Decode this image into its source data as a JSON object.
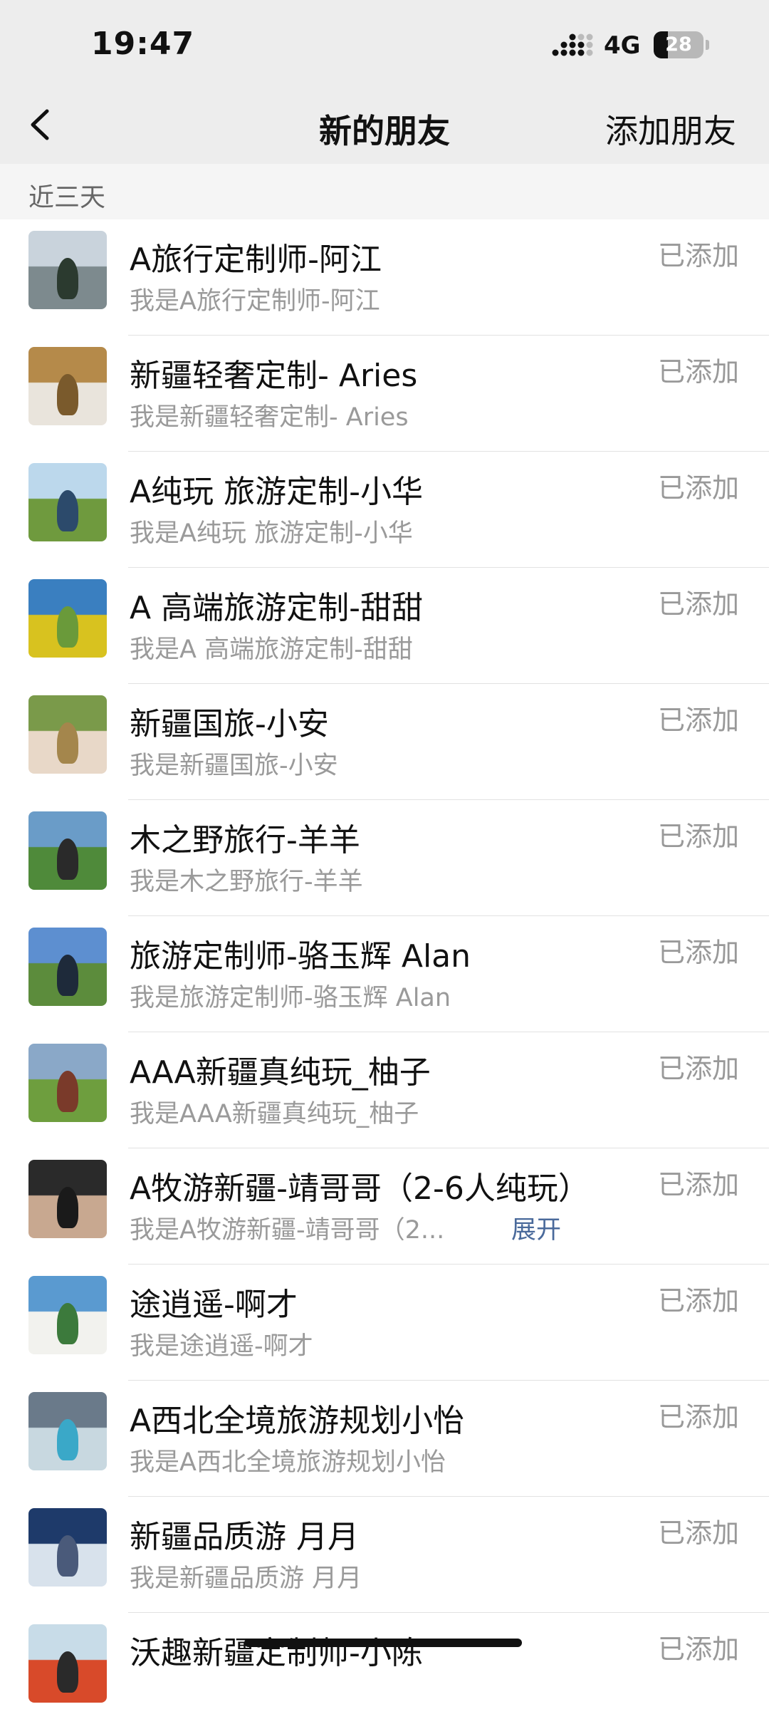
{
  "status_bar": {
    "time": "19:47",
    "network": "4G",
    "battery": "28",
    "battery_level": 0.28
  },
  "nav": {
    "title": "新的朋友",
    "action": "添加朋友",
    "back_icon": "chevron-left-icon"
  },
  "section": {
    "label": "近三天"
  },
  "requests": [
    {
      "name": "A旅行定制师-阿江",
      "message": "我是A旅行定制师-阿江",
      "status": "已添加",
      "avatar": [
        "#c9d3dc",
        "#7d8a8e",
        "#2b3a2f"
      ]
    },
    {
      "name": "新疆轻奢定制- Aries",
      "message": "我是新疆轻奢定制- Aries",
      "status": "已添加",
      "avatar": [
        "#b58a4a",
        "#e9e4dc",
        "#7a5a2c"
      ]
    },
    {
      "name": "A纯玩 旅游定制-小华",
      "message": "我是A纯玩 旅游定制-小华",
      "status": "已添加",
      "avatar": [
        "#bcd8ec",
        "#6f9a3e",
        "#2c4a6b"
      ]
    },
    {
      "name": "A 高端旅游定制-甜甜",
      "message": "我是A 高端旅游定制-甜甜",
      "status": "已添加",
      "avatar": [
        "#3a7fc0",
        "#d8c21f",
        "#6a9a3a"
      ]
    },
    {
      "name": "新疆国旅-小安",
      "message": "我是新疆国旅-小安",
      "status": "已添加",
      "avatar": [
        "#7a9a4a",
        "#e8d8c8",
        "#a4864c"
      ]
    },
    {
      "name": "木之野旅行-羊羊",
      "message": "我是木之野旅行-羊羊",
      "status": "已添加",
      "avatar": [
        "#6a9cc8",
        "#4f8a3a",
        "#2a2a2a"
      ]
    },
    {
      "name": "旅游定制师-骆玉辉 Alan",
      "message": "我是旅游定制师-骆玉辉 Alan",
      "status": "已添加",
      "avatar": [
        "#5d8fd0",
        "#5c8c3c",
        "#1e2a3a"
      ]
    },
    {
      "name": "AAA新疆真纯玩_柚子",
      "message": "我是AAA新疆真纯玩_柚子",
      "status": "已添加",
      "avatar": [
        "#8aa8c8",
        "#6e9e3e",
        "#7a3a2a"
      ]
    },
    {
      "name": "A牧游新疆-靖哥哥（2-6人纯玩）",
      "message": "我是A牧游新疆-靖哥哥（2...",
      "status": "已添加",
      "expand": "展开",
      "avatar": [
        "#2a2a2a",
        "#c8a890",
        "#1a1a1a"
      ]
    },
    {
      "name": "途逍遥-啊才",
      "message": "我是途逍遥-啊才",
      "status": "已添加",
      "avatar": [
        "#5a9ad0",
        "#f2f2ee",
        "#3c7a3c"
      ]
    },
    {
      "name": "A西北全境旅游规划小怡",
      "message": "我是A西北全境旅游规划小怡",
      "status": "已添加",
      "avatar": [
        "#6a7a8a",
        "#c8d8e0",
        "#3aa8c8"
      ]
    },
    {
      "name": "新疆品质游 月月",
      "message": "我是新疆品质游 月月",
      "status": "已添加",
      "avatar": [
        "#1e3a6a",
        "#d8e2ec",
        "#4a5a7a"
      ]
    },
    {
      "name": "沃趣新疆定制师-小陈",
      "message": "",
      "status": "已添加",
      "avatar": [
        "#c8dce8",
        "#d84a2a",
        "#2a2a2a"
      ]
    }
  ]
}
